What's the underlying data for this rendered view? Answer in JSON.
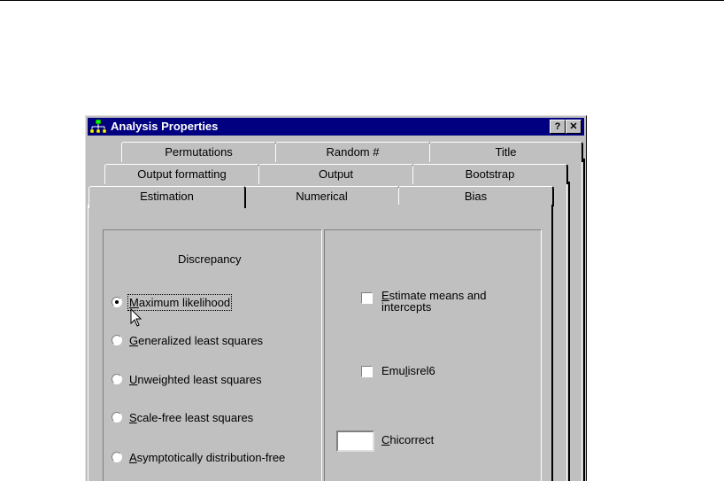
{
  "window": {
    "title": "Analysis Properties",
    "help_button": "?",
    "close_button": "✕"
  },
  "tabs": {
    "row1": [
      "Permutations",
      "Random #",
      "Title"
    ],
    "row2": [
      "Output formatting",
      "Output",
      "Bootstrap"
    ],
    "row3": [
      "Estimation",
      "Numerical",
      "Bias"
    ]
  },
  "estimation": {
    "discrepancy_label": "Discrepancy",
    "discrepancy_options": [
      {
        "letter": "M",
        "rest": "aximum likelihood",
        "selected": true
      },
      {
        "letter": "G",
        "rest": "eneralized least squares",
        "selected": false
      },
      {
        "letter": "U",
        "rest": "nweighted least squares",
        "selected": false
      },
      {
        "letter": "S",
        "rest": "cale-free least squares",
        "selected": false
      },
      {
        "letter": "A",
        "rest": "symptotically distribution-free",
        "selected": false
      }
    ],
    "estimate_means": {
      "first": "E",
      "rest": "stimate means and",
      "line2": "intercepts",
      "checked": false
    },
    "emulisrel": {
      "pre": "Emu",
      "letter": "l",
      "post": "isrel6",
      "checked": false
    },
    "chicorrect": {
      "letter": "C",
      "rest": "hicorrect",
      "value": ""
    }
  }
}
